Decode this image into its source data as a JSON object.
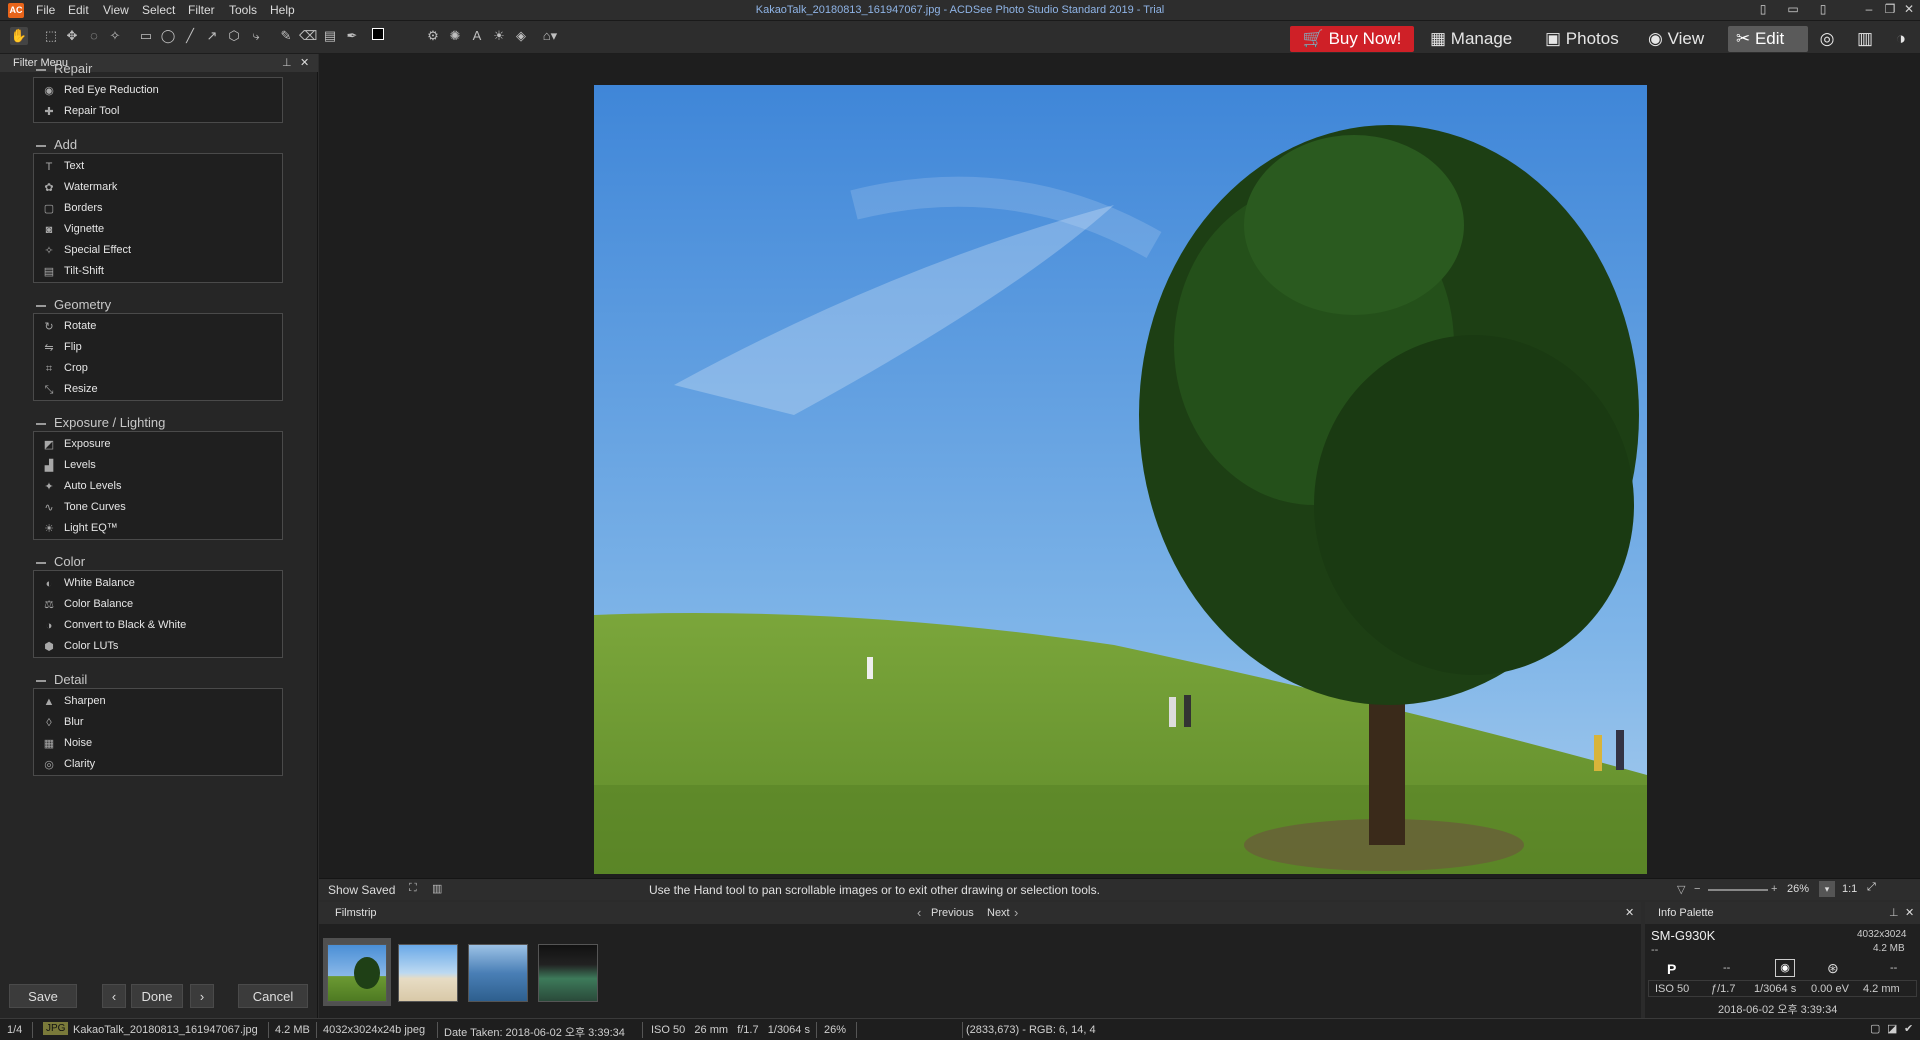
{
  "app": {
    "title": "KakaoTalk_20180813_161947067.jpg - ACDSee Photo Studio Standard 2019 - Trial",
    "menus": [
      "File",
      "Edit",
      "View",
      "Select",
      "Filter",
      "Tools",
      "Help"
    ]
  },
  "modes": {
    "buy": "Buy Now!",
    "manage": "Manage",
    "photos": "Photos",
    "view": "View",
    "edit": "Edit"
  },
  "filter_menu": {
    "title": "Filter Menu",
    "groups": [
      {
        "title": "Repair",
        "items": [
          "Red Eye Reduction",
          "Repair Tool"
        ]
      },
      {
        "title": "Add",
        "items": [
          "Text",
          "Watermark",
          "Borders",
          "Vignette",
          "Special Effect",
          "Tilt-Shift"
        ]
      },
      {
        "title": "Geometry",
        "items": [
          "Rotate",
          "Flip",
          "Crop",
          "Resize"
        ]
      },
      {
        "title": "Exposure / Lighting",
        "items": [
          "Exposure",
          "Levels",
          "Auto Levels",
          "Tone Curves",
          "Light EQ™"
        ]
      },
      {
        "title": "Color",
        "items": [
          "White Balance",
          "Color Balance",
          "Convert to Black & White",
          "Color LUTs"
        ]
      },
      {
        "title": "Detail",
        "items": [
          "Sharpen",
          "Blur",
          "Noise",
          "Clarity"
        ]
      }
    ]
  },
  "bottom_buttons": {
    "save": "Save",
    "done": "Done",
    "cancel": "Cancel"
  },
  "viewer": {
    "show_saved": "Show Saved",
    "hint": "Use the Hand tool to pan scrollable images or to exit other drawing or selection tools.",
    "zoom": "26%",
    "one_to_one": "1:1"
  },
  "filmstrip": {
    "title": "Filmstrip",
    "previous": "Previous",
    "next": "Next"
  },
  "info_palette": {
    "title": "Info Palette",
    "camera": "SM-G930K",
    "camera_sub": "--",
    "dimensions": "4032x3024",
    "size": "4.2 MB",
    "mode": "P",
    "flash": "--",
    "exp_comp": "--",
    "iso": "ISO 50",
    "aperture": "ƒ/1.7",
    "shutter": "1/3064 s",
    "ev": "0.00 eV",
    "focal": "4.2 mm",
    "date": "2018-06-02 오후 3:39:34"
  },
  "status": {
    "index": "1/4",
    "format": "JPG",
    "filename": "KakaoTalk_20180813_161947067.jpg",
    "filesize": "4.2 MB",
    "dims": "4032x3024x24b jpeg",
    "date_taken": "Date Taken: 2018-06-02 오후 3:39:34",
    "exposure": "ISO 50   26 mm   f/1.7   1/3064 s",
    "zoom": "26%",
    "pixel": "(2833,673) - RGB: 6, 14, 4"
  }
}
